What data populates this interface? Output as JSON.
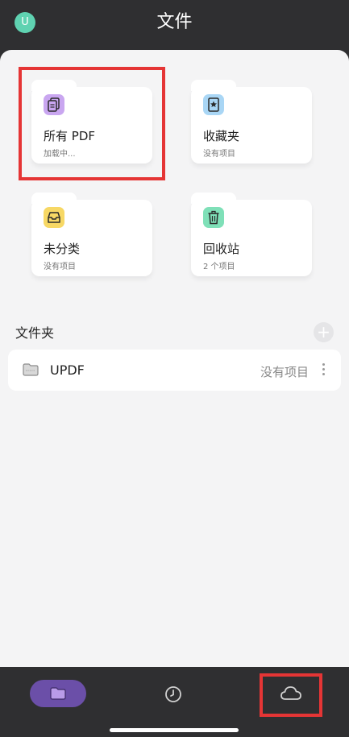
{
  "header": {
    "avatar_letter": "U",
    "title": "文件"
  },
  "cards": [
    {
      "title": "所有 PDF",
      "subtitle": "加载中...",
      "icon": "pdf-stack-icon",
      "color": "#c9a6f0"
    },
    {
      "title": "收藏夹",
      "subtitle": "没有项目",
      "icon": "star-bookmark-icon",
      "color": "#a9d6f5"
    },
    {
      "title": "未分类",
      "subtitle": "没有项目",
      "icon": "inbox-icon",
      "color": "#f7d865"
    },
    {
      "title": "回收站",
      "subtitle": "2 个项目",
      "icon": "trash-icon",
      "color": "#7fe0b8"
    }
  ],
  "folders_section": {
    "title": "文件夹",
    "add_label": "+",
    "items": [
      {
        "name": "UPDF",
        "count": "没有项目",
        "icon": "folder-icon"
      }
    ]
  },
  "bottom_nav": {
    "items": [
      {
        "name": "files",
        "icon": "folder-icon",
        "active": true,
        "color": "#6b4fa8"
      },
      {
        "name": "recent",
        "icon": "clock-icon",
        "active": false
      },
      {
        "name": "cloud",
        "icon": "cloud-icon",
        "active": false
      }
    ]
  },
  "colors": {
    "highlight": "#e53535",
    "background_dark": "#2f2f31",
    "sheet": "#f4f4f5"
  }
}
